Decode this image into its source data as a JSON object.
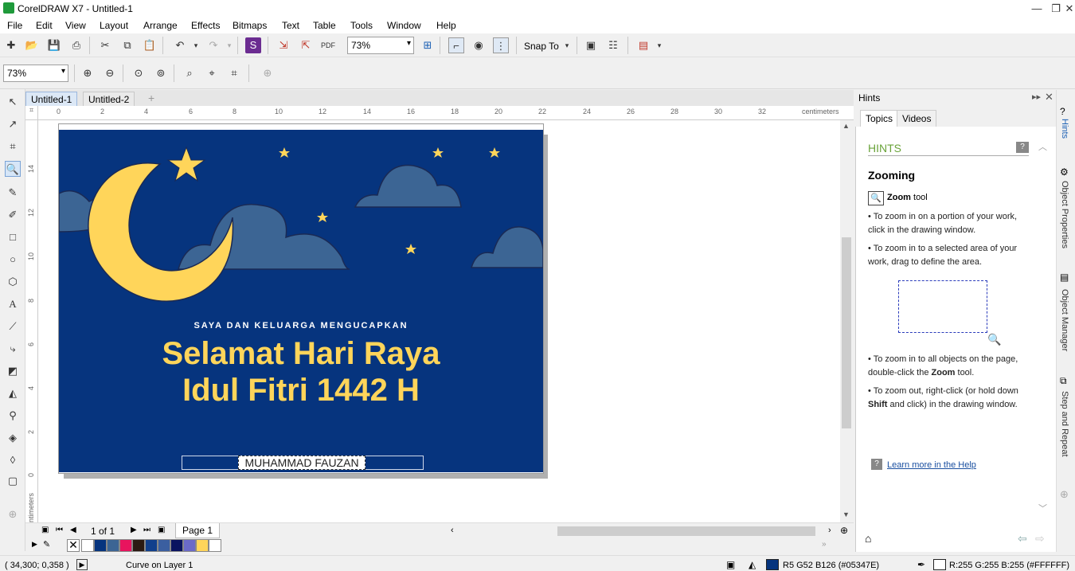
{
  "window": {
    "title": "CorelDRAW X7 - Untitled-1",
    "min": "—",
    "restore": "❐",
    "close": "✕"
  },
  "menu": [
    "File",
    "Edit",
    "View",
    "Layout",
    "Arrange",
    "Effects",
    "Bitmaps",
    "Text",
    "Table",
    "Tools",
    "Window",
    "Help"
  ],
  "toolbar": {
    "zoom_value": "73%",
    "snap_label": "Snap To"
  },
  "toolbar2": {
    "zoom_value": "73%"
  },
  "doc_tabs": [
    "Untitled-1",
    "Untitled-2"
  ],
  "ruler": {
    "h_ticks": [
      "0",
      "2",
      "4",
      "6",
      "8",
      "10",
      "12",
      "14",
      "16",
      "18",
      "20",
      "22",
      "24",
      "26",
      "28",
      "30",
      "32"
    ],
    "v_ticks": [
      "14",
      "12",
      "10",
      "8",
      "6",
      "4",
      "2",
      "0"
    ],
    "unit": "centimeters"
  },
  "card": {
    "subtitle": "SAYA DAN KELUARGA MENGUCAPKAN",
    "title_line1": "Selamat Hari Raya",
    "title_line2": "Idul Fitri 1442 H",
    "name": "MUHAMMAD FAUZAN",
    "bg_color": "#06347e",
    "accent_color": "#ffd55a",
    "cloud_color": "#3c6594"
  },
  "pagebar": {
    "page_count": "1 of 1",
    "page_tab": "Page 1"
  },
  "palette": [
    "#ffffff",
    "#06347e",
    "#3c6594",
    "#e8145e",
    "#2b1a12",
    "#113f8c",
    "#3b5fa0",
    "#0a1360",
    "#6b6ac8",
    "#ffd55a",
    "#ffffff"
  ],
  "status": {
    "coords": "( 34,300; 0,358 )",
    "object": "Curve on Layer 1",
    "fill": "R5 G52 B126 (#05347E)",
    "outline": "R:255 G:255 B:255 (#FFFFFF)",
    "fill_color": "#05347e"
  },
  "docker": {
    "title": "Hints",
    "tabs": [
      "Topics",
      "Videos"
    ],
    "heading": "HINTS",
    "section": "Zooming",
    "tool_label": "Zoom",
    "tool_suffix": " tool",
    "hints": [
      "To zoom in on a portion of your work, click in the drawing window.",
      "To zoom in to a selected area of your work, drag to define the area."
    ],
    "hint3_pre": "To zoom in to all objects on the page, double-click the ",
    "hint3_bold": "Zoom",
    "hint3_post": " tool.",
    "hint4_pre": "To zoom out, right-click (or hold down ",
    "hint4_bold": "Shift",
    "hint4_post": " and click) in the drawing window.",
    "help_link": "Learn more in the Help"
  },
  "side_tabs": [
    "Hints",
    "Object Properties",
    "Object Manager",
    "Step and Repeat"
  ]
}
